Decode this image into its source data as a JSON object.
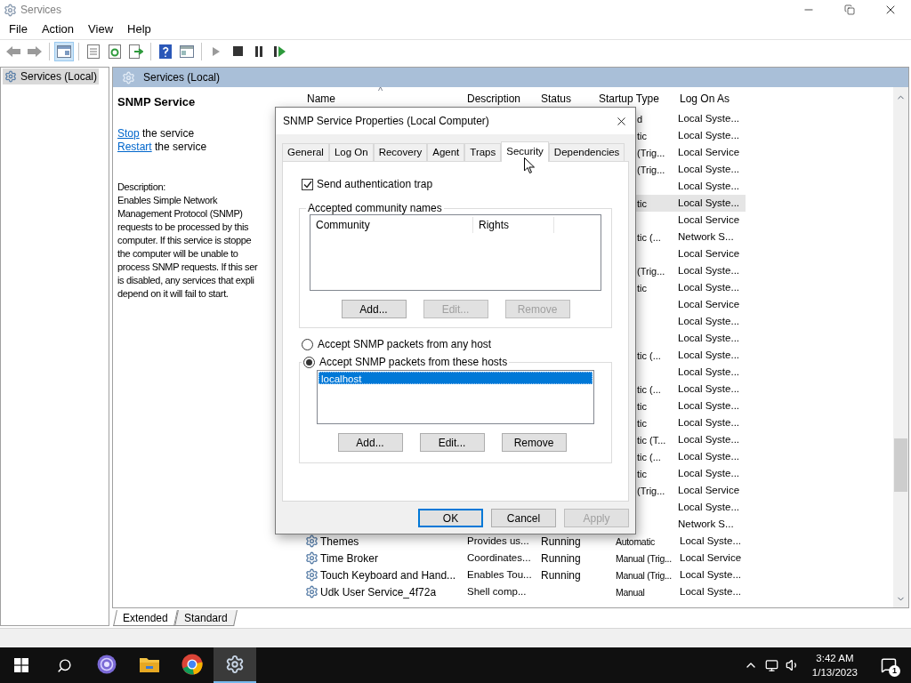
{
  "window": {
    "title": "Services",
    "menu": [
      "File",
      "Action",
      "View",
      "Help"
    ]
  },
  "toolbar": {
    "console_tree_pressed": true
  },
  "tree": {
    "items": [
      {
        "label": "Services (Local)",
        "selected": true
      }
    ]
  },
  "pane": {
    "title": "Services (Local)",
    "service_name": "SNMP Service",
    "actions": [
      {
        "link": "Stop",
        "text": "the service"
      },
      {
        "link": "Restart",
        "text": "the service"
      }
    ],
    "description_label": "Description:",
    "description_lines": [
      "Enables Simple Network",
      "Management Protocol (SNMP)",
      "requests to be processed by this",
      "computer. If this service is stoppe",
      "the computer will be unable to",
      "process SNMP requests. If this ser",
      "is disabled, any services that expli",
      "depend on it will fail to start."
    ]
  },
  "list": {
    "sort_mark": "^",
    "columns": [
      "Name",
      "Description",
      "Status",
      "Startup Type",
      "Log On As"
    ],
    "rows": [
      {
        "kind": "partial",
        "startup_type": "d",
        "log_on_as": "Local Syste...",
        "selected": false
      },
      {
        "kind": "partial",
        "startup_type": "tic",
        "log_on_as": "Local Syste...",
        "selected": false
      },
      {
        "kind": "partial",
        "startup_type": "(Trig...",
        "log_on_as": "Local Service",
        "selected": false
      },
      {
        "kind": "partial",
        "startup_type": "(Trig...",
        "log_on_as": "Local Syste...",
        "selected": false
      },
      {
        "kind": "partial",
        "log_on_as": "Local Syste...",
        "selected": false
      },
      {
        "kind": "partial",
        "startup_type": "tic",
        "log_on_as": "Local Syste...",
        "selected": true
      },
      {
        "kind": "partial",
        "log_on_as": "Local Service",
        "selected": false
      },
      {
        "kind": "partial",
        "startup_type": "tic (...",
        "log_on_as": "Network S...",
        "selected": false
      },
      {
        "kind": "partial",
        "log_on_as": "Local Service",
        "selected": false
      },
      {
        "kind": "partial",
        "startup_type": "(Trig...",
        "log_on_as": "Local Syste...",
        "selected": false
      },
      {
        "kind": "partial",
        "startup_type": "tic",
        "log_on_as": "Local Syste...",
        "selected": false
      },
      {
        "kind": "partial",
        "log_on_as": "Local Service",
        "selected": false
      },
      {
        "kind": "partial",
        "log_on_as": "Local Syste...",
        "selected": false
      },
      {
        "kind": "partial",
        "log_on_as": "Local Syste...",
        "selected": false
      },
      {
        "kind": "partial",
        "startup_type": "tic (...",
        "log_on_as": "Local Syste...",
        "selected": false
      },
      {
        "kind": "partial",
        "log_on_as": "Local Syste...",
        "selected": false
      },
      {
        "kind": "partial",
        "startup_type": "tic (...",
        "log_on_as": "Local Syste...",
        "selected": false
      },
      {
        "kind": "partial",
        "startup_type": "tic",
        "log_on_as": "Local Syste...",
        "selected": false
      },
      {
        "kind": "partial",
        "startup_type": "tic",
        "log_on_as": "Local Syste...",
        "selected": false
      },
      {
        "kind": "partial",
        "startup_type": "tic (T...",
        "log_on_as": "Local Syste...",
        "selected": false
      },
      {
        "kind": "partial",
        "startup_type": "tic (...",
        "log_on_as": "Local Syste...",
        "selected": false
      },
      {
        "kind": "partial",
        "startup_type": "tic",
        "log_on_as": "Local Syste...",
        "selected": false
      },
      {
        "kind": "partial",
        "startup_type": "(Trig...",
        "log_on_as": "Local Service",
        "selected": false
      },
      {
        "kind": "partial",
        "log_on_as": "Local Syste...",
        "selected": false
      },
      {
        "kind": "partial",
        "log_on_as": "Network S...",
        "selected": false
      },
      {
        "kind": "full",
        "name": "Themes",
        "description": "Provides us...",
        "status": "Running",
        "startup_type": "Automatic",
        "log_on_as": "Local Syste...",
        "selected": false
      },
      {
        "kind": "full",
        "name": "Time Broker",
        "description": "Coordinates...",
        "status": "Running",
        "startup_type": "Manual (Trig...",
        "log_on_as": "Local Service",
        "selected": false
      },
      {
        "kind": "full",
        "name": "Touch Keyboard and Hand...",
        "description": "Enables Tou...",
        "status": "Running",
        "startup_type": "Manual (Trig...",
        "log_on_as": "Local Syste...",
        "selected": false
      },
      {
        "kind": "full",
        "name": "Udk User Service_4f72a",
        "description": "Shell comp...",
        "startup_type": "Manual",
        "log_on_as": "Local Syste...",
        "selected": false
      }
    ]
  },
  "view_tabs": [
    {
      "label": "Extended",
      "selected": true
    },
    {
      "label": "Standard",
      "selected": false
    }
  ],
  "dialog": {
    "title": "SNMP Service Properties (Local Computer)",
    "tabs": [
      {
        "label": "General",
        "selected": false
      },
      {
        "label": "Log On",
        "selected": false
      },
      {
        "label": "Recovery",
        "selected": false
      },
      {
        "label": "Agent",
        "selected": false
      },
      {
        "label": "Traps",
        "selected": false
      },
      {
        "label": "Security",
        "selected": true
      },
      {
        "label": "Dependencies",
        "selected": false
      }
    ],
    "send_trap": {
      "label": "Send authentication trap",
      "checked": true
    },
    "community_group": {
      "title": "Accepted community names",
      "columns": [
        "Community",
        "Rights"
      ],
      "buttons": [
        {
          "label": "Add...",
          "disabled": false
        },
        {
          "label": "Edit...",
          "disabled": true
        },
        {
          "label": "Remove",
          "disabled": true
        }
      ]
    },
    "host_options": [
      {
        "label": "Accept SNMP packets from any host",
        "selected": false
      },
      {
        "label": "Accept SNMP packets from these hosts",
        "selected": true
      }
    ],
    "hosts": [
      {
        "name": "localhost",
        "selected": true
      }
    ],
    "host_buttons": [
      {
        "label": "Add...",
        "disabled": false
      },
      {
        "label": "Edit...",
        "disabled": false
      },
      {
        "label": "Remove",
        "disabled": false
      }
    ],
    "buttons": [
      {
        "label": "OK",
        "kind": "default",
        "disabled": false
      },
      {
        "label": "Cancel",
        "kind": "normal",
        "disabled": false
      },
      {
        "label": "Apply",
        "kind": "normal",
        "disabled": true
      }
    ]
  },
  "taskbar": {
    "time": "3:42 AM",
    "date": "1/13/2023",
    "notifications": "1",
    "apps": [
      {
        "kind": "torrent",
        "active": false
      },
      {
        "kind": "folder",
        "active": false
      },
      {
        "kind": "browser",
        "active": false
      },
      {
        "kind": "services",
        "active": true
      }
    ]
  }
}
